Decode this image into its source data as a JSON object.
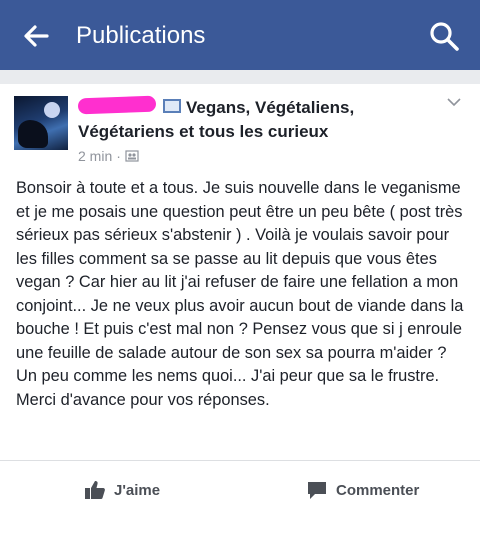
{
  "app_bar": {
    "title": "Publications"
  },
  "post": {
    "author": "Vegans, Végétaliens, Végétariens et tous les curieux",
    "time": "2 min",
    "separator": "·",
    "text": "Bonsoir à toute et a tous. Je suis nouvelle dans le veganisme et je me posais une question peut être un peu bête ( post très sérieux pas sérieux s'abstenir ) . Voilà je voulais savoir pour les filles comment sa se passe au lit depuis que vous êtes vegan ? Car hier au lit j'ai refuser de faire une fellation a mon conjoint... Je ne veux plus avoir aucun bout de viande dans la bouche ! Et puis c'est mal non ?  Pensez vous que si j enroule une feuille de salade autour de son sex sa pourra m'aider ? Un peu comme les nems quoi... J'ai peur que sa le frustre. Merci d'avance pour vos réponses."
  },
  "actions": {
    "like": "J'aime",
    "comment": "Commenter"
  },
  "colors": {
    "brand": "#3b5998",
    "redaction": "#ff2fcf"
  }
}
